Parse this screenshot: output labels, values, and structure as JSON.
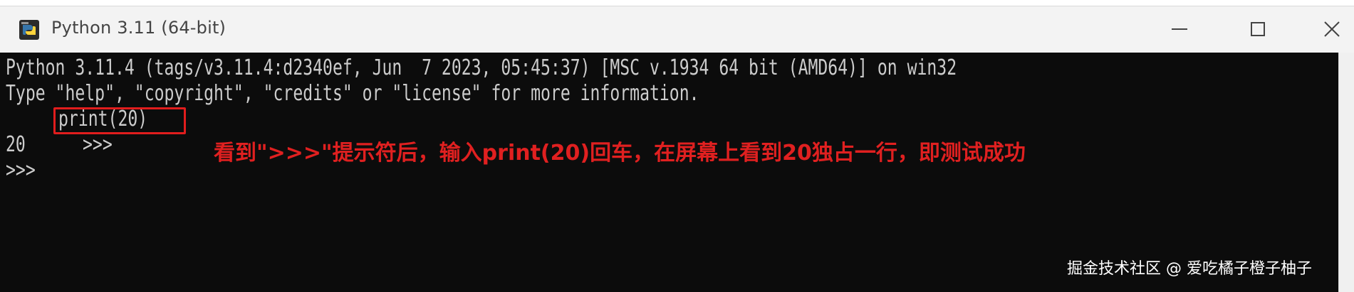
{
  "window": {
    "title": "Python 3.11 (64-bit)",
    "icon": "python-icon"
  },
  "controls": {
    "minimize_icon": "minimize-icon",
    "maximize_icon": "maximize-icon",
    "close_icon": "close-icon"
  },
  "console": {
    "banner_line1": "Python 3.11.4 (tags/v3.11.4:d2340ef, Jun  7 2023, 05:45:37) [MSC v.1934 64 bit (AMD64)] on win32",
    "banner_line2": "Type \"help\", \"copyright\", \"credits\" or \"license\" for more information.",
    "prompt": ">>>",
    "command": "print(20)",
    "output": "20",
    "next_prompt": ">>>"
  },
  "annotation": {
    "text": "看到\">>>\"提示符后，输入print(20)回车，在屏幕上看到20独占一行，即测试成功",
    "color": "#e02020"
  },
  "watermark": {
    "text": "掘金技术社区 @ 爱吃橘子橙子柚子"
  },
  "colors": {
    "console_bg": "#0c0c0c",
    "console_text": "#cccccc",
    "highlight": "#e11d1d",
    "titlebar": "#f3f3f3"
  }
}
